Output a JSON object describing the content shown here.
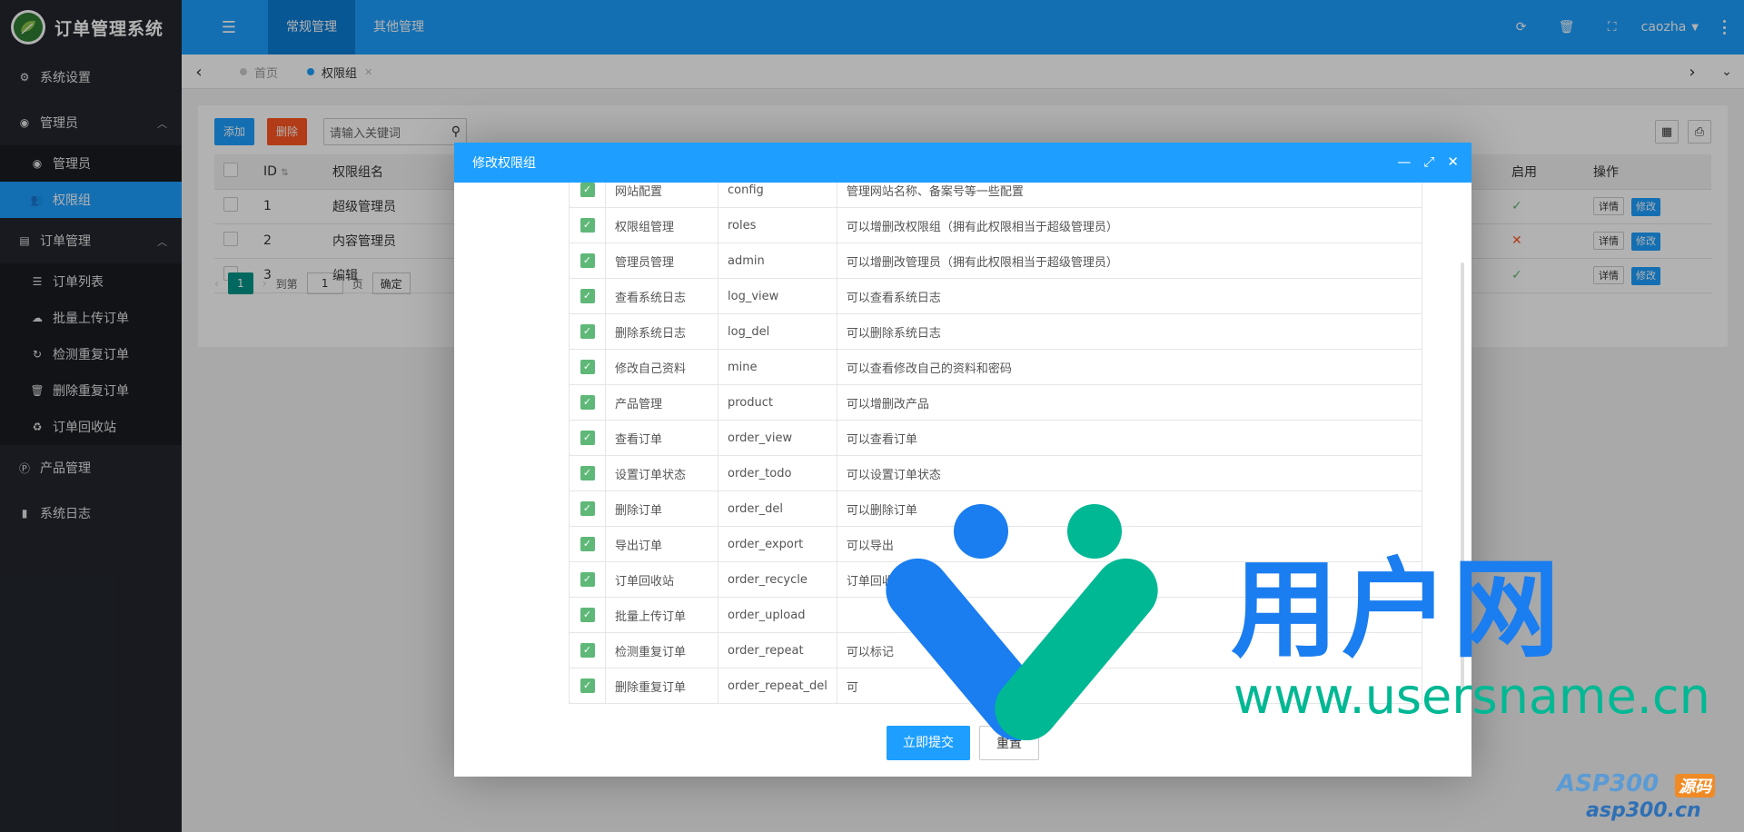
{
  "app": {
    "title": "订单管理系统",
    "user": "caozha"
  },
  "top_nav": [
    {
      "label": "常规管理"
    },
    {
      "label": "其他管理"
    }
  ],
  "sidebar": {
    "items": [
      {
        "label": "系统设置",
        "icon": "gears-icon"
      },
      {
        "label": "管理员",
        "icon": "user-circle-icon",
        "expanded": true,
        "children": [
          {
            "label": "管理员",
            "icon": "user-circle-icon"
          },
          {
            "label": "权限组",
            "icon": "users-icon",
            "active": true
          }
        ]
      },
      {
        "label": "订单管理",
        "icon": "list-box-icon",
        "expanded": true,
        "children": [
          {
            "label": "订单列表",
            "icon": "list-icon"
          },
          {
            "label": "批量上传订单",
            "icon": "upload-icon"
          },
          {
            "label": "检测重复订单",
            "icon": "refresh-icon"
          },
          {
            "label": "删除重复订单",
            "icon": "trash-icon"
          },
          {
            "label": "订单回收站",
            "icon": "recycle-icon"
          }
        ]
      },
      {
        "label": "产品管理",
        "icon": "product-icon"
      },
      {
        "label": "系统日志",
        "icon": "file-icon"
      }
    ]
  },
  "tabs": [
    {
      "label": "首页"
    },
    {
      "label": "权限组",
      "active": true
    }
  ],
  "toolbar": {
    "add_label": "添加",
    "delete_label": "删除",
    "search_placeholder": "请输入关键词"
  },
  "grid": {
    "headers": [
      "ID",
      "权限组名",
      "启用",
      "操作"
    ],
    "rows": [
      {
        "id": "1",
        "name": "超级管理员",
        "enabled": "✓"
      },
      {
        "id": "2",
        "name": "内容管理员",
        "enabled": "✕"
      },
      {
        "id": "3",
        "name": "编辑",
        "enabled": "✓"
      }
    ],
    "detail_label": "详情",
    "edit_label": "修改"
  },
  "pager": {
    "page": "1",
    "goto_label": "到第",
    "page_input": "1",
    "page_suffix": "页",
    "confirm_label": "确定"
  },
  "modal": {
    "title": "修改权限组",
    "permissions": [
      {
        "name": "网站配置",
        "code": "config",
        "desc": "管理网站名称、备案号等一些配置"
      },
      {
        "name": "权限组管理",
        "code": "roles",
        "desc": "可以增删改权限组（拥有此权限相当于超级管理员）"
      },
      {
        "name": "管理员管理",
        "code": "admin",
        "desc": "可以增删改管理员（拥有此权限相当于超级管理员）"
      },
      {
        "name": "查看系统日志",
        "code": "log_view",
        "desc": "可以查看系统日志"
      },
      {
        "name": "删除系统日志",
        "code": "log_del",
        "desc": "可以删除系统日志"
      },
      {
        "name": "修改自己资料",
        "code": "mine",
        "desc": "可以查看修改自己的资料和密码"
      },
      {
        "name": "产品管理",
        "code": "product",
        "desc": "可以增删改产品"
      },
      {
        "name": "查看订单",
        "code": "order_view",
        "desc": "可以查看订单"
      },
      {
        "name": "设置订单状态",
        "code": "order_todo",
        "desc": "可以设置订单状态"
      },
      {
        "name": "删除订单",
        "code": "order_del",
        "desc": "可以删除订单"
      },
      {
        "name": "导出订单",
        "code": "order_export",
        "desc": "可以导出"
      },
      {
        "name": "订单回收站",
        "code": "order_recycle",
        "desc": "订单回收站"
      },
      {
        "name": "批量上传订单",
        "code": "order_upload",
        "desc": ""
      },
      {
        "name": "检测重复订单",
        "code": "order_repeat",
        "desc": "可以标记"
      },
      {
        "name": "删除重复订单",
        "code": "order_repeat_del",
        "desc": "可"
      }
    ],
    "submit_label": "立即提交",
    "reset_label": "重置"
  },
  "watermark": {
    "brand": "用户网",
    "url": "www.usersname.cn",
    "asp_a": "ASP300",
    "asp_b": "源码",
    "asp_url": "asp300.cn"
  },
  "colors": {
    "primary": "#1e9fff",
    "sidebar": "#23262e",
    "danger": "#ff5722",
    "success": "#5fb878",
    "teal": "#009688"
  }
}
